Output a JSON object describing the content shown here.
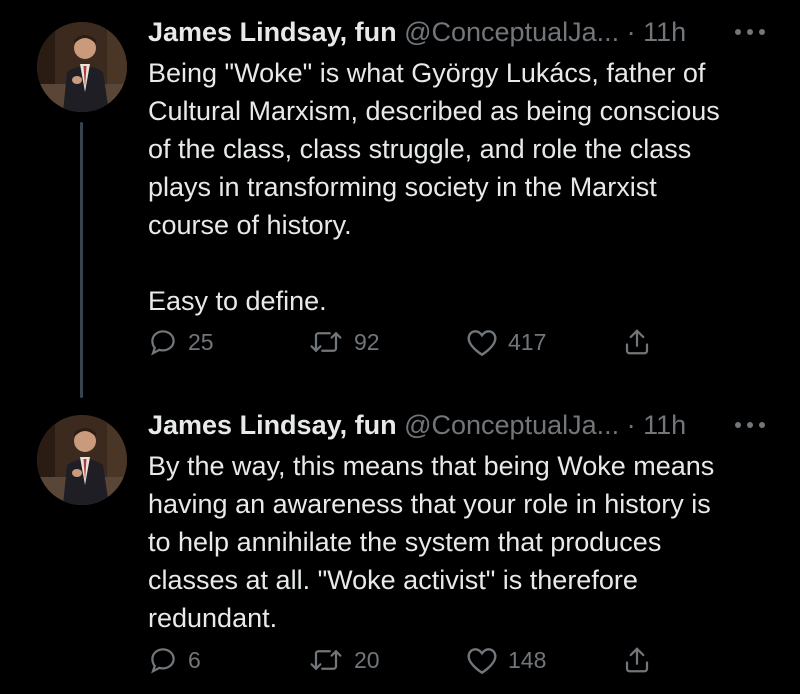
{
  "colors": {
    "background": "#000000",
    "text": "#e7e9ea",
    "muted": "#71767b",
    "thread_line": "#38444d"
  },
  "tweets": [
    {
      "author_name": "James Lindsay, fun",
      "handle": "@ConceptualJa...",
      "separator": "·",
      "time": "11h",
      "text": "Being \"Woke\" is what György Lukács, father of\nCultural Marxism, described as being conscious\nof the class, class struggle, and role the class\nplays in transforming society in the Marxist\ncourse of history.\n\nEasy to define.",
      "replies": "25",
      "retweets": "92",
      "likes": "417",
      "icons": [
        "reply-icon",
        "retweet-icon",
        "like-icon",
        "share-icon",
        "more-icon"
      ]
    },
    {
      "author_name": "James Lindsay, fun",
      "handle": "@ConceptualJa...",
      "separator": "·",
      "time": "11h",
      "text": "By the way, this means that being Woke means\nhaving an awareness that your role in history is\nto help annihilate the system that produces\nclasses at all. \"Woke activist\" is therefore\nredundant.",
      "replies": "6",
      "retweets": "20",
      "likes": "148",
      "icons": [
        "reply-icon",
        "retweet-icon",
        "like-icon",
        "share-icon",
        "more-icon"
      ]
    }
  ]
}
